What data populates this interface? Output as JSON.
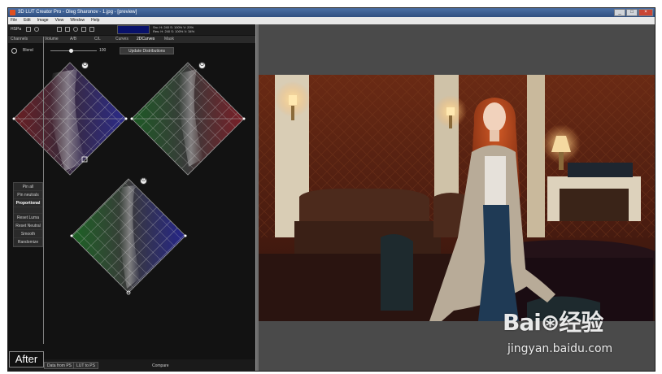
{
  "window": {
    "title": "3D LUT Creator Pro - Oleg Sharonov - 1.jpg - [preview]",
    "controls": [
      "_",
      "□",
      "×"
    ]
  },
  "menu": [
    "File",
    "Edit",
    "Image",
    "View",
    "Window",
    "Help"
  ],
  "toolbar": {
    "mode": "HSPa",
    "readout_line1": "Src: H: 240  S: 100%  V: 20%",
    "readout_line2": "Res: H: 240  S: 100%  V: 34%",
    "readout_color": "#08116a"
  },
  "tabs": [
    {
      "label": "Channels",
      "active": false
    },
    {
      "label": "Volume",
      "active": false
    },
    {
      "label": "A/B",
      "active": false
    },
    {
      "label": "C/L",
      "active": false
    },
    {
      "label": "Curves",
      "active": false
    },
    {
      "label": "2DCurves",
      "active": true
    },
    {
      "label": "Mask",
      "active": false
    }
  ],
  "blend": {
    "label": "Blend",
    "value": "100",
    "level": 0.45
  },
  "update_button": "Update Distributions",
  "side_buttons": [
    "Pin all",
    "Pin neutrals",
    "Proportional",
    "Reset Luma",
    "Reset Neutral",
    "Smooth",
    "Randomize"
  ],
  "bottom": {
    "btn_from_ps": "Data from PS",
    "btn_lut_to_ps": "LUT to PS",
    "compare": "Compare"
  },
  "after_label": "After",
  "watermark": {
    "logo": "Bai⊛经验",
    "url": "jingyan.baidu.com"
  },
  "icons": [
    "power-icon",
    "pin-icon",
    "zoom-icon",
    "grid-icon"
  ]
}
